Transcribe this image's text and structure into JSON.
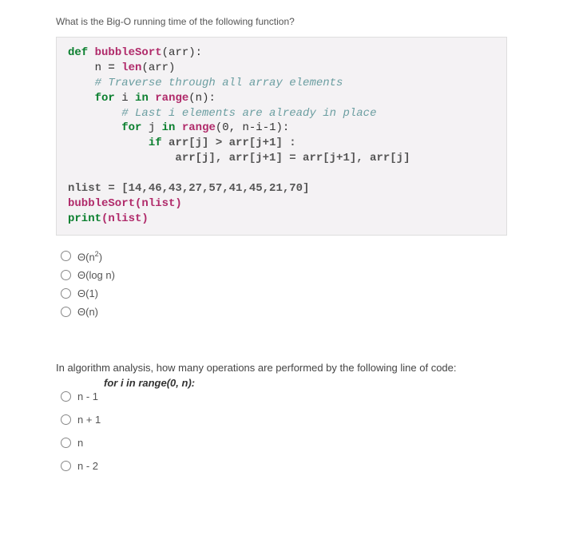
{
  "q1": {
    "prompt": "What is the Big-O running time of the following function?",
    "code": {
      "l1_kw": "def",
      "l1_fn": "bubbleSort",
      "l1_rest": "(arr):",
      "l2_var": "n",
      "l2_eq": " = ",
      "l2_fn": "len",
      "l2_rest": "(arr)",
      "l3_cmt": "# Traverse through all array elements",
      "l4_kw1": "for",
      "l4_var": " i ",
      "l4_kw2": "in",
      "l4_fn": " range",
      "l4_rest": "(n):",
      "l5_cmt": "# Last i elements are already in place",
      "l6_kw1": "for",
      "l6_var": " j ",
      "l6_kw2": "in",
      "l6_fn": " range",
      "l6_rest": "(0, n-i-1):",
      "l7_kw": "if",
      "l7_rest": " arr[j] > arr[j+1] :",
      "l8": "arr[j], arr[j+1] = arr[j+1], arr[j]",
      "bl_nlist": "nlist = [14,46,43,27,57,41,45,21,70]",
      "bl_call": "bubbleSort(nlist)",
      "bl_print_kw": "print",
      "bl_print_rest": "(nlist)"
    },
    "options": {
      "a": "Θ(n²)",
      "b": "Θ(log n)",
      "c": "Θ(1)",
      "d": "Θ(n)"
    }
  },
  "q2": {
    "prompt": "In algorithm analysis, how many operations are performed by the following line of code:",
    "codeline": "for i in range(0, n):",
    "options": {
      "a": "n - 1",
      "b": "n + 1",
      "c": "n",
      "d": "n - 2"
    }
  }
}
